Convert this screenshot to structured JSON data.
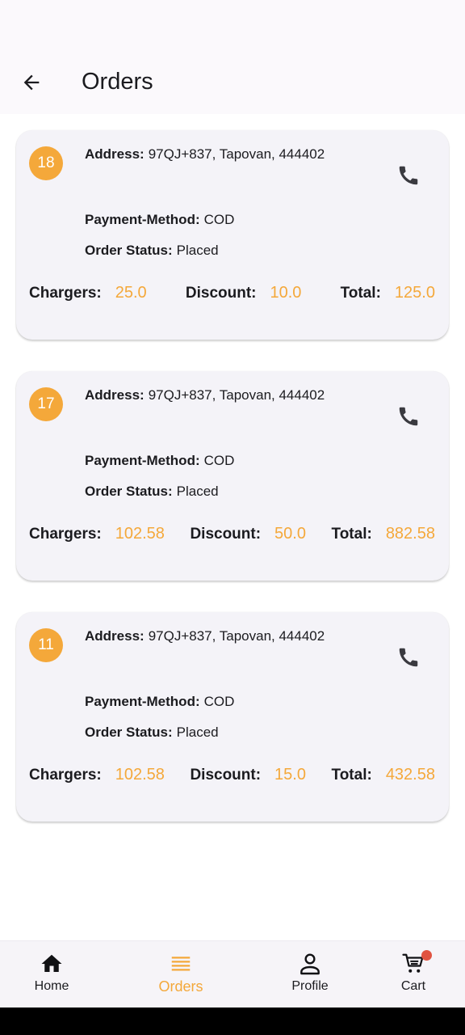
{
  "header": {
    "title": "Orders"
  },
  "labels": {
    "address": "Address:",
    "payment": "Payment-Method:",
    "status": "Order Status:",
    "charges": "Chargers:",
    "discount": "Discount:",
    "total": "Total:"
  },
  "orders": [
    {
      "id": "18",
      "address": "97QJ+837, Tapovan, 444402",
      "payment_method": "COD",
      "status": "Placed",
      "charges": "25.0",
      "discount": "10.0",
      "total": "125.0"
    },
    {
      "id": "17",
      "address": "97QJ+837, Tapovan, 444402",
      "payment_method": "COD",
      "status": "Placed",
      "charges": "102.58",
      "discount": "50.0",
      "total": "882.58"
    },
    {
      "id": "11",
      "address": "97QJ+837, Tapovan, 444402",
      "payment_method": "COD",
      "status": "Placed",
      "charges": "102.58",
      "discount": "15.0",
      "total": "432.58"
    }
  ],
  "bottom_nav": {
    "items": [
      {
        "label": "Home",
        "icon": "home-icon"
      },
      {
        "label": "Orders",
        "icon": "list-icon",
        "active": true
      },
      {
        "label": "Profile",
        "icon": "person-icon"
      },
      {
        "label": "Cart",
        "icon": "cart-icon",
        "has_notification_dot": true
      }
    ]
  },
  "colors": {
    "accent": "#f4a83a",
    "card_bg": "#f4f3f8",
    "notification_dot": "#e05341"
  }
}
